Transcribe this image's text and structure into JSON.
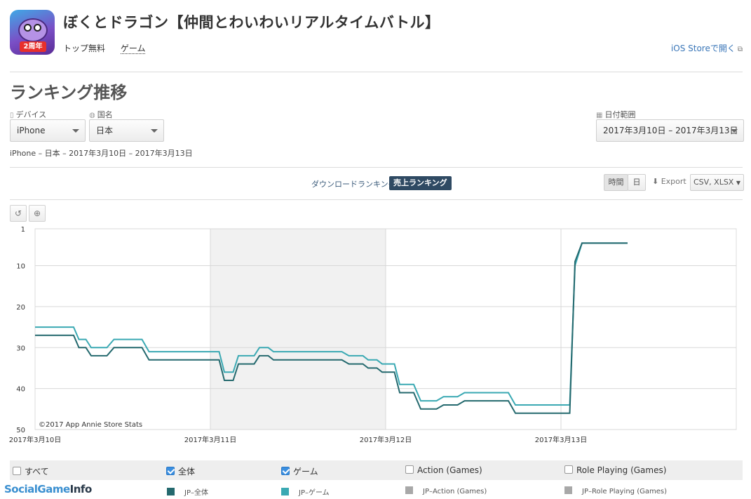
{
  "app": {
    "title": "ぼくとドラゴン【仲間とわいわいリアルタイムバトル】",
    "icon_badge": "2周年",
    "category": "トップ無料",
    "genre": "ゲーム",
    "store_link": "iOS Storeで開く"
  },
  "page": {
    "title": "ランキング推移",
    "summary": "iPhone – 日本 – 2017年3月10日 – 2017年3月13日"
  },
  "filters": {
    "device_label": "デバイス",
    "device_value": "iPhone",
    "country_label": "国名",
    "country_value": "日本",
    "date_label": "日付範囲",
    "date_value": "2017年3月10日 – 2017年3月13日"
  },
  "tabs": {
    "download": "ダウンロードランキング",
    "sales": "売上ランキング"
  },
  "controls": {
    "hour": "時間",
    "day": "日",
    "export": "Export",
    "format": "CSV, XLSX"
  },
  "icons": {
    "device": "phone-icon",
    "country": "globe-icon",
    "date": "calendar-icon",
    "export": "download-icon",
    "reset": "undo-icon",
    "zoom": "zoom-icon",
    "external": "external-link-icon"
  },
  "chart_data": {
    "type": "line",
    "y_reversed": true,
    "ylim": [
      1,
      50
    ],
    "yticks": [
      1,
      10,
      20,
      30,
      40,
      50
    ],
    "xticks": [
      "2017年3月10日",
      "2017年3月11日",
      "2017年3月12日",
      "2017年3月13日"
    ],
    "x_day_bounds": [
      0,
      4.0
    ],
    "shaded_days": [
      [
        1,
        2
      ]
    ],
    "credit": "©2017 App Annie Store Stats",
    "series": [
      {
        "name": "JP-全体",
        "color": "#24696e",
        "points": [
          [
            0.0,
            27
          ],
          [
            0.22,
            27
          ],
          [
            0.25,
            30
          ],
          [
            0.29,
            30
          ],
          [
            0.32,
            32
          ],
          [
            0.41,
            32
          ],
          [
            0.45,
            30
          ],
          [
            0.61,
            30
          ],
          [
            0.65,
            33
          ],
          [
            1.05,
            33
          ],
          [
            1.08,
            38
          ],
          [
            1.13,
            38
          ],
          [
            1.16,
            34
          ],
          [
            1.25,
            34
          ],
          [
            1.28,
            32
          ],
          [
            1.33,
            32
          ],
          [
            1.36,
            33
          ],
          [
            1.75,
            33
          ],
          [
            1.79,
            34
          ],
          [
            1.87,
            34
          ],
          [
            1.9,
            35
          ],
          [
            1.95,
            35
          ],
          [
            1.98,
            36
          ],
          [
            2.05,
            36
          ],
          [
            2.08,
            41
          ],
          [
            2.16,
            41
          ],
          [
            2.2,
            45
          ],
          [
            2.29,
            45
          ],
          [
            2.33,
            44
          ],
          [
            2.41,
            44
          ],
          [
            2.45,
            43
          ],
          [
            2.7,
            43
          ],
          [
            2.74,
            46
          ],
          [
            3.05,
            46
          ],
          [
            3.08,
            9
          ],
          [
            3.12,
            4.5
          ],
          [
            3.38,
            4.5
          ]
        ]
      },
      {
        "name": "JP-ゲーム",
        "color": "#3aa9b3",
        "points": [
          [
            0.0,
            25
          ],
          [
            0.22,
            25
          ],
          [
            0.25,
            28
          ],
          [
            0.29,
            28
          ],
          [
            0.32,
            30
          ],
          [
            0.41,
            30
          ],
          [
            0.45,
            28
          ],
          [
            0.61,
            28
          ],
          [
            0.65,
            31
          ],
          [
            1.05,
            31
          ],
          [
            1.08,
            36
          ],
          [
            1.13,
            36
          ],
          [
            1.16,
            32
          ],
          [
            1.25,
            32
          ],
          [
            1.28,
            30
          ],
          [
            1.33,
            30
          ],
          [
            1.36,
            31
          ],
          [
            1.75,
            31
          ],
          [
            1.79,
            32
          ],
          [
            1.87,
            32
          ],
          [
            1.9,
            33
          ],
          [
            1.95,
            33
          ],
          [
            1.98,
            34
          ],
          [
            2.05,
            34
          ],
          [
            2.08,
            39
          ],
          [
            2.16,
            39
          ],
          [
            2.2,
            43
          ],
          [
            2.29,
            43
          ],
          [
            2.33,
            42
          ],
          [
            2.41,
            42
          ],
          [
            2.45,
            41
          ],
          [
            2.7,
            41
          ],
          [
            2.74,
            44
          ],
          [
            3.05,
            44
          ],
          [
            3.08,
            10
          ],
          [
            3.12,
            4.5
          ],
          [
            3.38,
            4.5
          ]
        ]
      }
    ],
    "legend_checkboxes": [
      {
        "label": "すべて",
        "checked": false
      },
      {
        "label": "全体",
        "checked": true
      },
      {
        "label": "ゲーム",
        "checked": true
      },
      {
        "label": "Action (Games)",
        "checked": false
      },
      {
        "label": "Role Playing (Games)",
        "checked": false
      }
    ],
    "legend_swatches": [
      {
        "label": "JP–全体",
        "color": "#24696e"
      },
      {
        "label": "JP–ゲーム",
        "color": "#3aa9b3"
      },
      {
        "label": "JP–Action (Games)",
        "color": "#a8a8a8"
      },
      {
        "label": "JP–Role Playing (Games)",
        "color": "#a8a8a8"
      }
    ]
  },
  "watermark": {
    "part1": "Social",
    "part2": "Game",
    "part3": "Info"
  }
}
